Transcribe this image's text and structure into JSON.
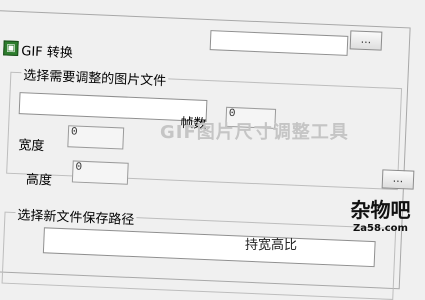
{
  "window": {
    "title": "GIF 转换",
    "icon": "app-icon"
  },
  "source_group": {
    "label": "选择需要调整的图片文件",
    "browse_label": "...",
    "file_path": "",
    "frames_label": "帧数",
    "frames_value": "0",
    "width_label": "宽度",
    "width_value": "0",
    "height_label": "高度",
    "height_value": "0"
  },
  "overlay_title": "GIF图片尺寸调整工具",
  "dest_group": {
    "label": "选择新文件保存路径",
    "browse_label": "...",
    "file_path": ""
  },
  "partial_text": "持宽高比",
  "watermark": {
    "name": "杂物吧",
    "url": "Za58.com"
  }
}
